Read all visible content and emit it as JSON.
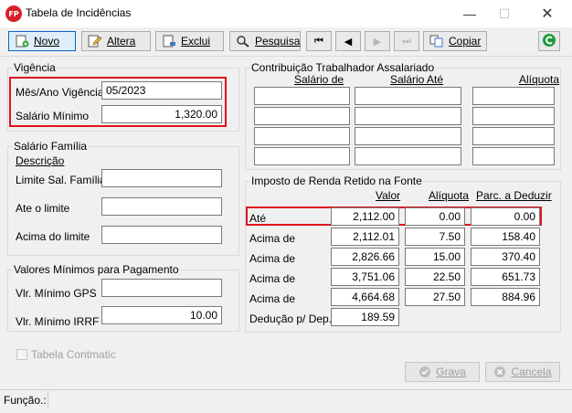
{
  "window": {
    "title": "Tabela de Incidências",
    "icon_text": "FP"
  },
  "toolbar": {
    "novo": "Novo",
    "altera": "Altera",
    "exclui": "Exclui",
    "pesquisa": "Pesquisa",
    "copiar": "Copiar"
  },
  "vigencia": {
    "title": "Vigência",
    "mes_ano_label": "Mês/Ano Vigência",
    "mes_ano_value": "05/2023",
    "salario_minimo_label": "Salário Mínimo",
    "salario_minimo_value": "1,320.00"
  },
  "salario_familia": {
    "title": "Salário Família",
    "descricao_header": "Descrição",
    "limite_label": "Limite Sal. Família",
    "ate_label": "Ate o limite",
    "acima_label": "Acima do limite"
  },
  "valores_minimos": {
    "title": "Valores Mínimos para Pagamento",
    "gps_label": "Vlr. Mínimo GPS",
    "irrf_label": "Vlr. Mínimo IRRF",
    "irrf_value": "10.00"
  },
  "contribuicao": {
    "title": "Contribuição Trabalhador Assalariado",
    "col_salario_de": "Salário de",
    "col_salario_ate": "Salário Até",
    "col_aliquota": "Alíquota"
  },
  "irrf": {
    "title": "Imposto de Renda Retido na Fonte",
    "col_valor": "Valor",
    "col_aliquota": "Alíquota",
    "col_parcela": "Parc. a Deduzir",
    "rows": [
      {
        "label": "Até",
        "valor": "2,112.00",
        "aliquota": "0.00",
        "parcela": "0.00"
      },
      {
        "label": "Acima de",
        "valor": "2,112.01",
        "aliquota": "7.50",
        "parcela": "158.40"
      },
      {
        "label": "Acima de",
        "valor": "2,826.66",
        "aliquota": "15.00",
        "parcela": "370.40"
      },
      {
        "label": "Acima de",
        "valor": "3,751.06",
        "aliquota": "22.50",
        "parcela": "651.73"
      },
      {
        "label": "Acima de",
        "valor": "4,664.68",
        "aliquota": "27.50",
        "parcela": "884.96"
      }
    ],
    "deducao_label": "Dedução p/ Dep.",
    "deducao_value": "189.59"
  },
  "footer": {
    "tabela_contmatic": "Tabela Contmatic",
    "grava": "Grava",
    "cancela": "Cancela",
    "funcao_label": "Função.:"
  },
  "colors": {
    "highlight": "#e0141e",
    "accent": "#0a64c8",
    "app_icon": "#d8202b"
  }
}
